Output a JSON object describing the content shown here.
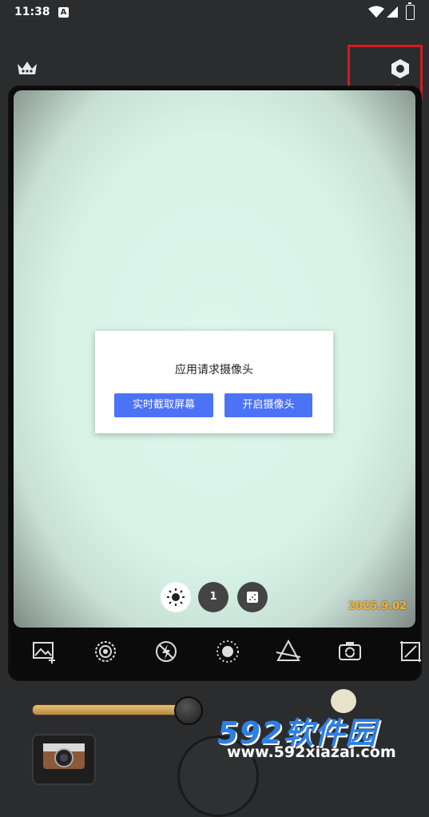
{
  "status_bar": {
    "time": "11:38",
    "notif_icon_letter": "A"
  },
  "top_bar": {
    "left_icon": "crown-icon",
    "right_icon": "settings-hexagon-icon"
  },
  "dialog": {
    "message": "应用请求摄像头",
    "btn_capture": "实时截取屏幕",
    "btn_camera": "开启摄像头",
    "accent": "#4c73f5"
  },
  "preview_controls": {
    "exposure_icon": "sun-icon",
    "count": "1",
    "grain_icon": "grain-icon"
  },
  "datestamp": "2025.9.02",
  "toolbar": {
    "items": [
      "add-image-icon",
      "focus-ring-icon",
      "flash-off-icon",
      "vignette-icon",
      "prism-icon",
      "flip-camera-icon",
      "crop-icon"
    ]
  },
  "watermark": {
    "brand": "592软件园",
    "url": "www.592xiazai.com"
  },
  "colors": {
    "background": "#2b2c2e",
    "highlight": "#d21d1d",
    "datestamp": "#f2b23a"
  }
}
